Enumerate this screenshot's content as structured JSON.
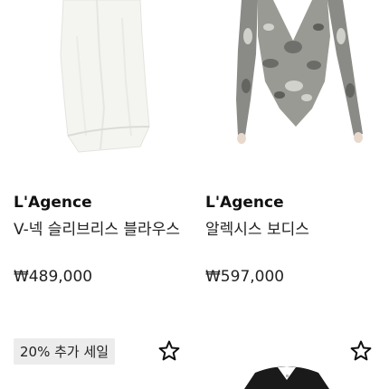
{
  "products": [
    {
      "brand": "L'Agence",
      "name": "V-넥 슬리브리스 블라우스",
      "price": "₩489,000",
      "image": "white-sleeveless-blouse"
    },
    {
      "brand": "L'Agence",
      "name": "알렉시스 보디스",
      "price": "₩597,000",
      "image": "snake-print-bodysuit"
    },
    {
      "badge": "20% 추가 세일",
      "image": "product-image-partial",
      "wishlist_icon": "star-outline-icon"
    },
    {
      "image": "black-top-partial",
      "wishlist_icon": "star-outline-icon"
    }
  ],
  "colors": {
    "text": "#111111",
    "badge_bg": "#ececec"
  }
}
